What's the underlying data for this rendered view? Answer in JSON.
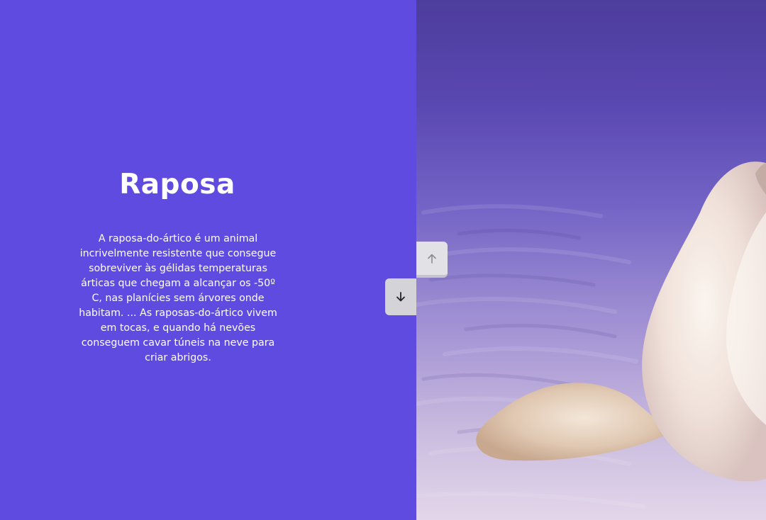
{
  "slide": {
    "title": "Raposa",
    "description": "A raposa-do-ártico é um animal incrivelmente resistente que consegue sobreviver às gélidas temperaturas árticas que chegam a alcançar os -50º C, nas planícies sem árvores onde habitam. ... As raposas-do-ártico vivem em tocas, e quando há nevões conseguem cavar túneis na neve para criar abrigos."
  },
  "controls": {
    "up_icon": "arrow-up-icon",
    "down_icon": "arrow-down-icon"
  },
  "image": {
    "subject": "arctic-fox-image"
  },
  "colors": {
    "panel_background": "#5f4bdf",
    "text": "#ffffff",
    "button_up": "#e2e2e6",
    "button_down": "#d4d4d8"
  }
}
